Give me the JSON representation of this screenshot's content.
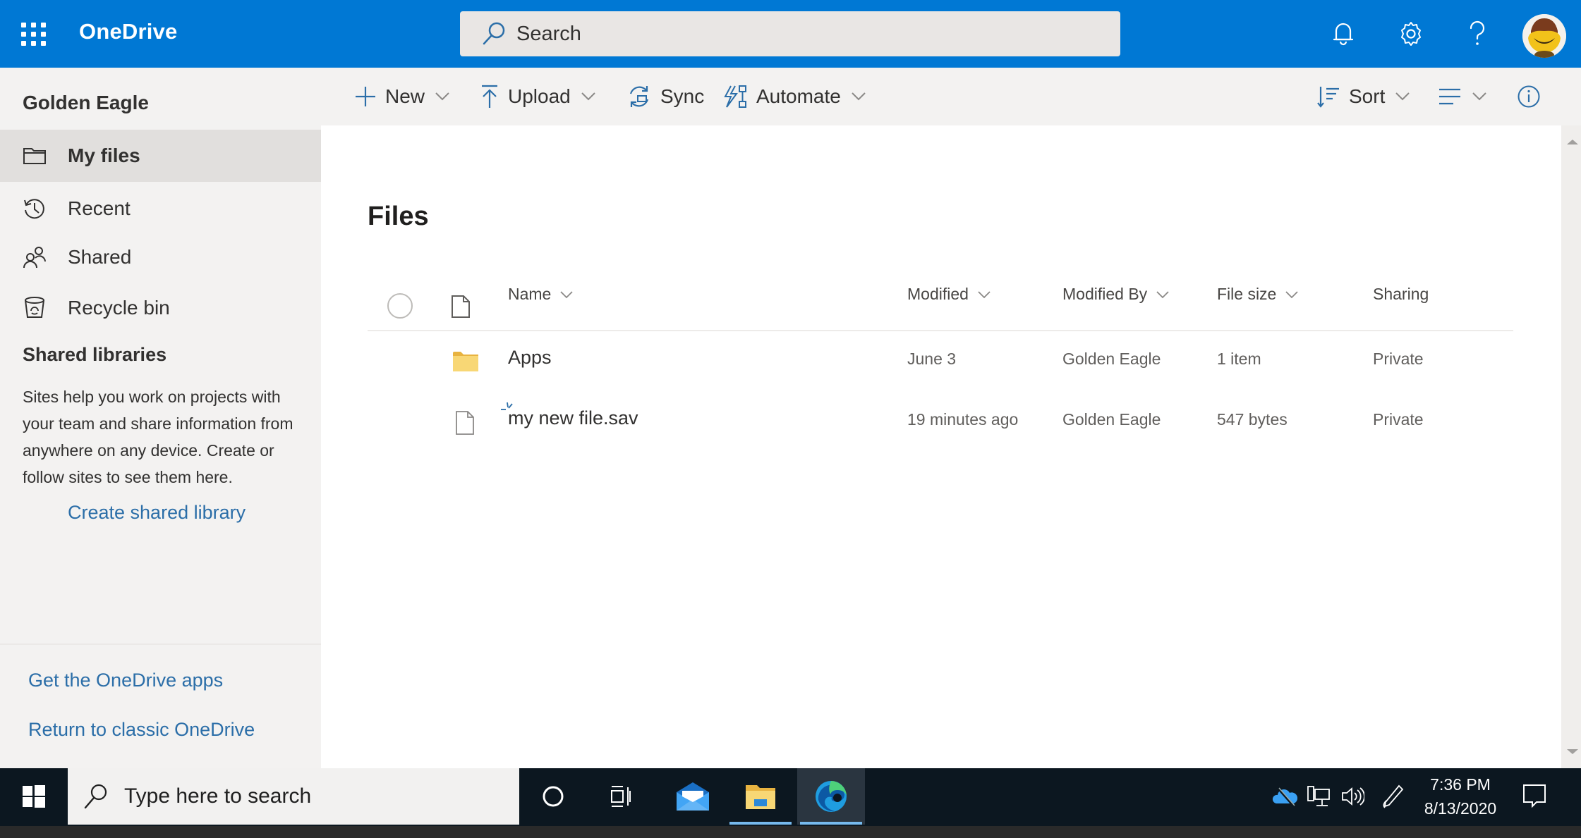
{
  "header": {
    "app_title": "OneDrive",
    "search_placeholder": "Search",
    "icons": [
      "waffle-icon",
      "bell-icon",
      "gear-icon",
      "help-icon",
      "avatar"
    ]
  },
  "commandbar": {
    "new_label": "New",
    "upload_label": "Upload",
    "sync_label": "Sync",
    "automate_label": "Automate",
    "sort_label": "Sort"
  },
  "sidebar": {
    "user_name": "Golden Eagle",
    "items": [
      {
        "label": "My files",
        "icon": "folder-icon",
        "active": true
      },
      {
        "label": "Recent",
        "icon": "history-icon",
        "active": false
      },
      {
        "label": "Shared",
        "icon": "people-icon",
        "active": false
      },
      {
        "label": "Recycle bin",
        "icon": "recycle-bin-icon",
        "active": false
      }
    ],
    "shared_libraries_title": "Shared libraries",
    "shared_libraries_desc": "Sites help you work on projects with your team and share information from anywhere on any device. Create or follow sites to see them here.",
    "create_library_link": "Create shared library",
    "get_apps_link": "Get the OneDrive apps",
    "classic_link": "Return to classic OneDrive"
  },
  "main": {
    "title": "Files",
    "columns": {
      "name": "Name",
      "modified": "Modified",
      "modified_by": "Modified By",
      "file_size": "File size",
      "sharing": "Sharing"
    },
    "rows": [
      {
        "type": "folder",
        "name": "Apps",
        "modified": "June 3",
        "modified_by": "Golden Eagle",
        "file_size": "1 item",
        "sharing": "Private",
        "new": false
      },
      {
        "type": "file",
        "name": "my new file.sav",
        "modified": "19 minutes ago",
        "modified_by": "Golden Eagle",
        "file_size": "547 bytes",
        "sharing": "Private",
        "new": true
      }
    ]
  },
  "taskbar": {
    "search_placeholder": "Type here to search",
    "time": "7:36 PM",
    "date": "8/13/2020"
  },
  "colors": {
    "brand": "#0078d4",
    "link": "#2b6ea8",
    "folder": "#f8d775"
  }
}
